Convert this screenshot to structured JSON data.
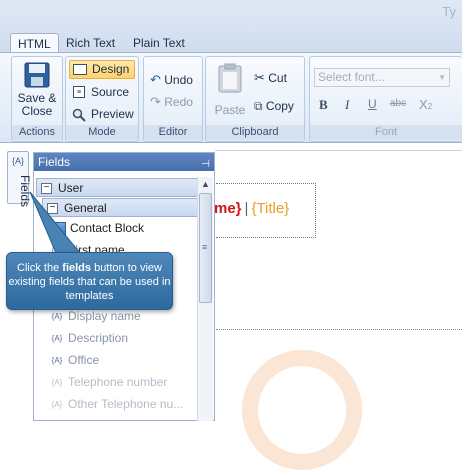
{
  "window": {
    "title_fragment": "Ty"
  },
  "tabs": [
    {
      "label": "HTML",
      "active": true
    },
    {
      "label": "Rich Text",
      "active": false
    },
    {
      "label": "Plain Text",
      "active": false
    }
  ],
  "ribbon": {
    "actions": {
      "save_close_line1": "Save &",
      "save_close_line2": "Close",
      "group_label": "Actions"
    },
    "mode": {
      "design": "Design",
      "source": "Source",
      "preview": "Preview",
      "group_label": "Mode"
    },
    "editor": {
      "undo": "Undo",
      "redo": "Redo",
      "group_label": "Editor"
    },
    "clipboard": {
      "paste": "Paste",
      "cut": "Cut",
      "copy": "Copy",
      "group_label": "Clipboard"
    },
    "font": {
      "placeholder": "Select font...",
      "group_label": "Font",
      "bold": "B",
      "italic": "I",
      "underline": "U",
      "strike": "abc",
      "subscript": "X",
      "subscript_digit": "2"
    }
  },
  "side_tab": {
    "label": "Fields",
    "icon_text": "{A}"
  },
  "fields_panel": {
    "title": "Fields",
    "root": "User",
    "group": "General",
    "items": [
      {
        "label": "Contact Block",
        "state": "normal"
      },
      {
        "label": "First name",
        "state": "normal"
      },
      {
        "label": "Display name",
        "state": "faded"
      },
      {
        "label": "Description",
        "state": "faded"
      },
      {
        "label": "Office",
        "state": "faded"
      },
      {
        "label": "Telephone number",
        "state": "faded2"
      },
      {
        "label": "Other Telephone nu...",
        "state": "faded2"
      }
    ]
  },
  "editor": {
    "name_fragment": "me}",
    "separator": "|",
    "title_token": "{Title}"
  },
  "callout": {
    "prefix": "Click the ",
    "bold_word": "fields",
    "suffix": " button to view existing fields that can be used in templates"
  },
  "colors": {
    "accent": "#466fab",
    "name_red": "#d11616",
    "title_orange": "#e8a020",
    "callout_blue": "#3a76aa"
  }
}
